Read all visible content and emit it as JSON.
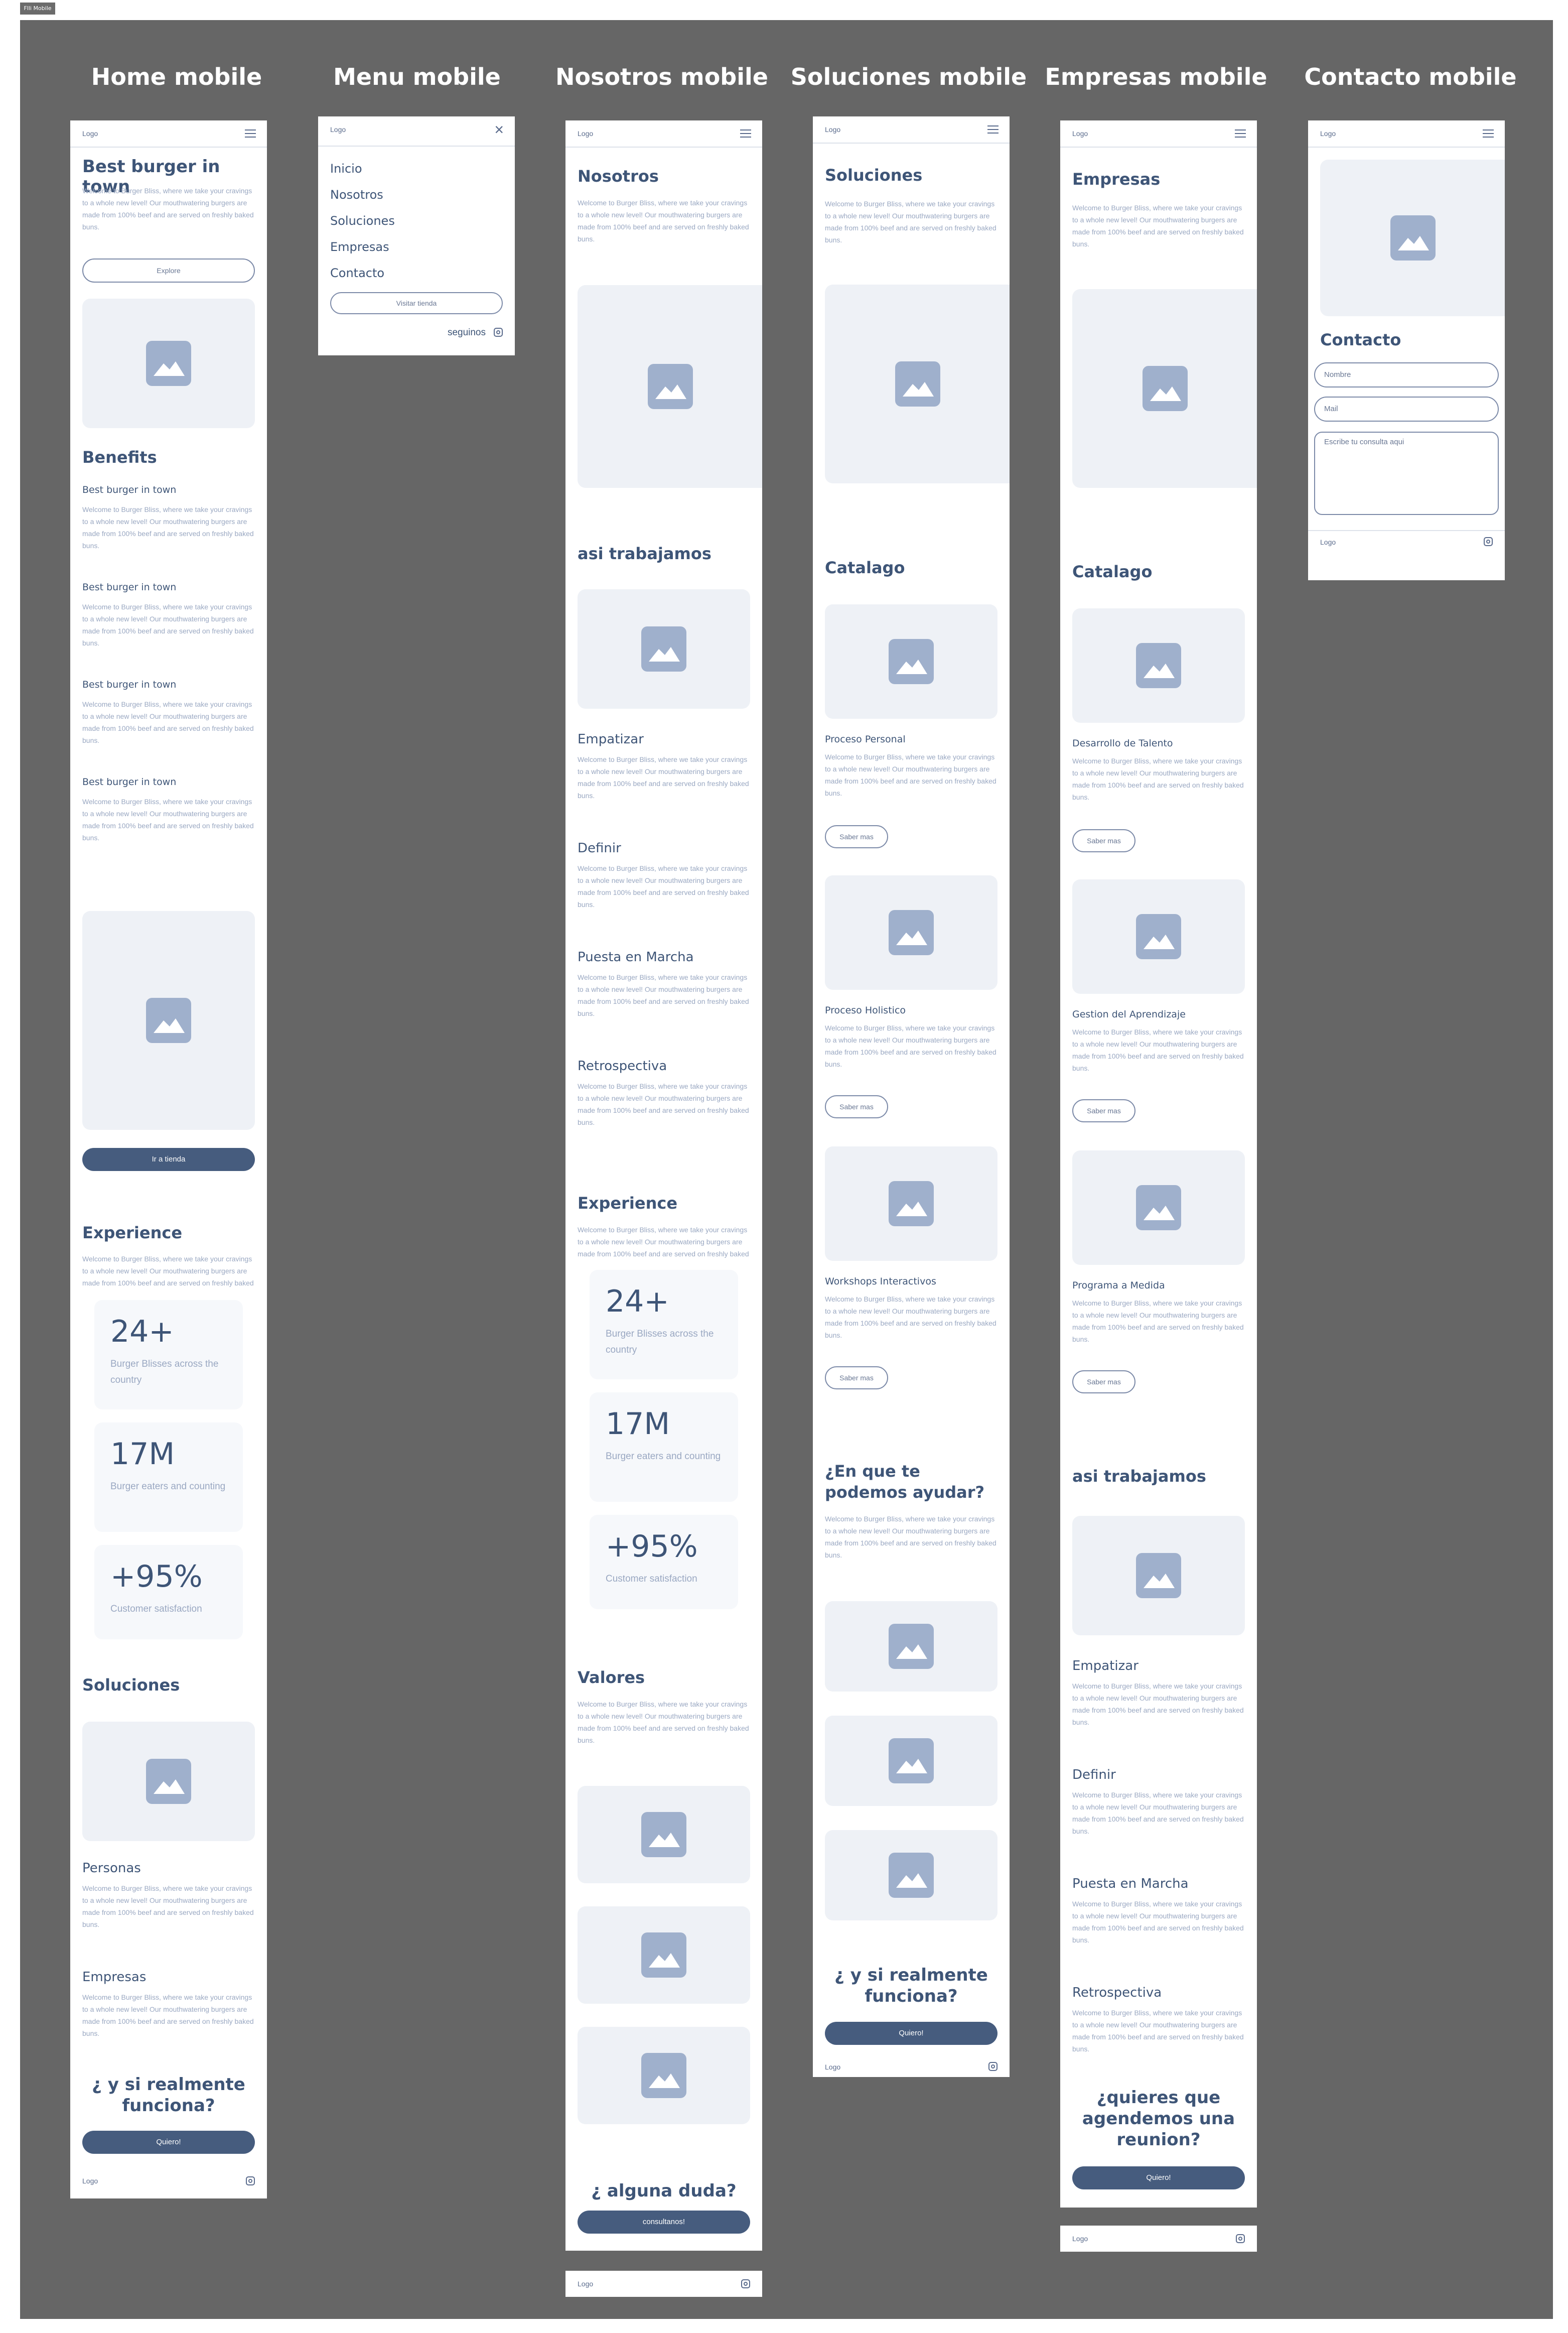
{
  "page_badge": "Flli Mobile",
  "frames": {
    "home": "Home mobile",
    "menu": "Menu mobile",
    "nosotros": "Nosotros mobile",
    "soluciones": "Soluciones mobile",
    "empresas": "Empresas mobile",
    "contacto": "Contacto mobile"
  },
  "common": {
    "logo": "Logo",
    "lorem": "Welcome to Burger Bliss, where we take your cravings to a whole new level! Our mouthwatering burgers are made from 100% beef and are served on freshly baked buns.",
    "lorem_cut": "Welcome to Burger Bliss, where we take your cravings to a whole new level! Our mouthwatering burgers are made from 100% beef and are served on freshly baked",
    "image_icon": "image-placeholder-icon",
    "menu_icon": "hamburger-menu-icon",
    "social_icon": "instagram-icon"
  },
  "stats": [
    {
      "value": "24+",
      "label": "Burger Blisses across the country"
    },
    {
      "value": "17M",
      "label": "Burger eaters and counting"
    },
    {
      "value": "+95%",
      "label": "Customer satisfaction"
    }
  ],
  "home": {
    "hero_title": "Best burger in town",
    "explore": "Explore",
    "benefits_title": "Benefits",
    "benefit_item": "Best burger in town",
    "ir_tienda": "Ir a tienda",
    "experience": "Experience",
    "soluciones": "Soluciones",
    "personas": "Personas",
    "empresas": "Empresas",
    "cta_title": "¿ y si realmente funciona?",
    "cta_button": "Quiero!"
  },
  "menu": {
    "items": [
      "Inicio",
      "Nosotros",
      "Soluciones",
      "Empresas",
      "Contacto"
    ],
    "visit": "Visitar tienda",
    "follow": "seguinos"
  },
  "nosotros": {
    "title": "Nosotros",
    "trabajamos": "asi trabajamos",
    "steps": [
      "Empatizar",
      "Definir",
      "Puesta en Marcha",
      "Retrospectiva"
    ],
    "experience": "Experience",
    "valores": "Valores",
    "cta_title": "¿ alguna duda?",
    "cta_button": "consultanos!"
  },
  "soluciones": {
    "title": "Soluciones",
    "catalogo": "Catalago",
    "items": [
      "Proceso Personal",
      "Proceso Holistico",
      "Workshops Interactivos"
    ],
    "saber": "Saber mas",
    "ayudar": "¿En que te podemos ayudar?",
    "cta_title": "¿ y si realmente funciona?",
    "cta_button": "Quiero!"
  },
  "empresas": {
    "title": "Empresas",
    "catalogo": "Catalago",
    "items": [
      "Desarrollo de Talento",
      "Gestion del Aprendizaje",
      "Programa a Medida"
    ],
    "saber": "Saber mas",
    "trabajamos": "asi trabajamos",
    "steps": [
      "Empatizar",
      "Definir",
      "Puesta en Marcha",
      "Retrospectiva"
    ],
    "cta_title": "¿quieres que agendemos una reunion?",
    "cta_button": "Quiero!"
  },
  "contacto": {
    "title": "Contacto",
    "name_placeholder": "Nombre",
    "mail_placeholder": "Mail",
    "query_placeholder": "Escribe tu consulta aqui"
  }
}
